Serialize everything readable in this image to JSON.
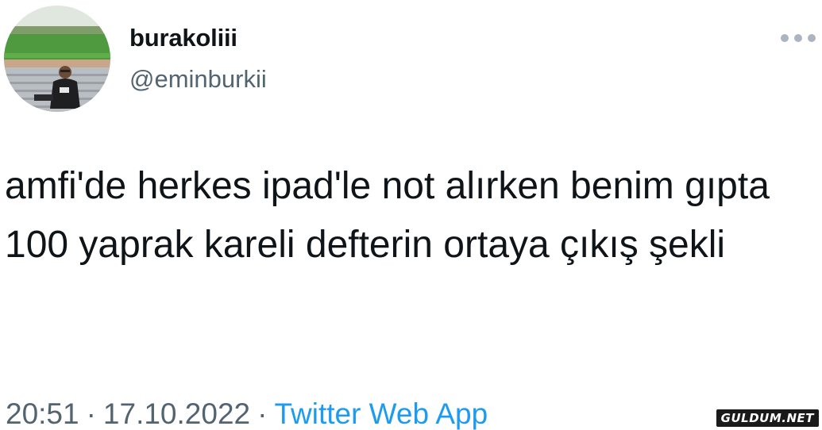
{
  "tweet": {
    "display_name": "burakoliii",
    "handle": "@eminburkii",
    "text": "amfi'de herkes ipad'le not alırken benim gıpta 100 yaprak kareli defterin ortaya çıkış şekli",
    "time": "20:51",
    "separator": "·",
    "date": "17.10.2022",
    "source": "Twitter Web App",
    "more_icon": "more-horizontal-icon"
  },
  "watermark": {
    "text": "GULDUM.NET"
  },
  "colors": {
    "text": "#0f1419",
    "secondary": "#536471",
    "link": "#1d9bf0",
    "more_dots": "#aab5bf"
  }
}
